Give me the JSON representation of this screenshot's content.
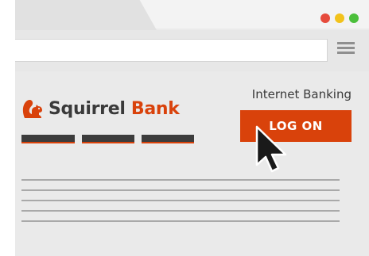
{
  "browser": {
    "window_controls": {
      "close_color": "#e64b3c",
      "minimize_color": "#f2c21b",
      "maximize_color": "#4bbf3b"
    },
    "menu_icon": "hamburger-menu-icon"
  },
  "page": {
    "brand": {
      "name_part1": "Squirrel ",
      "name_part2": "Bank",
      "logo_icon": "squirrel-icon",
      "accent_color": "#d9420b"
    },
    "internet_banking_label": "Internet Banking",
    "logon_button_label": "LOG ON",
    "pointer": "arrow-cursor-icon"
  }
}
